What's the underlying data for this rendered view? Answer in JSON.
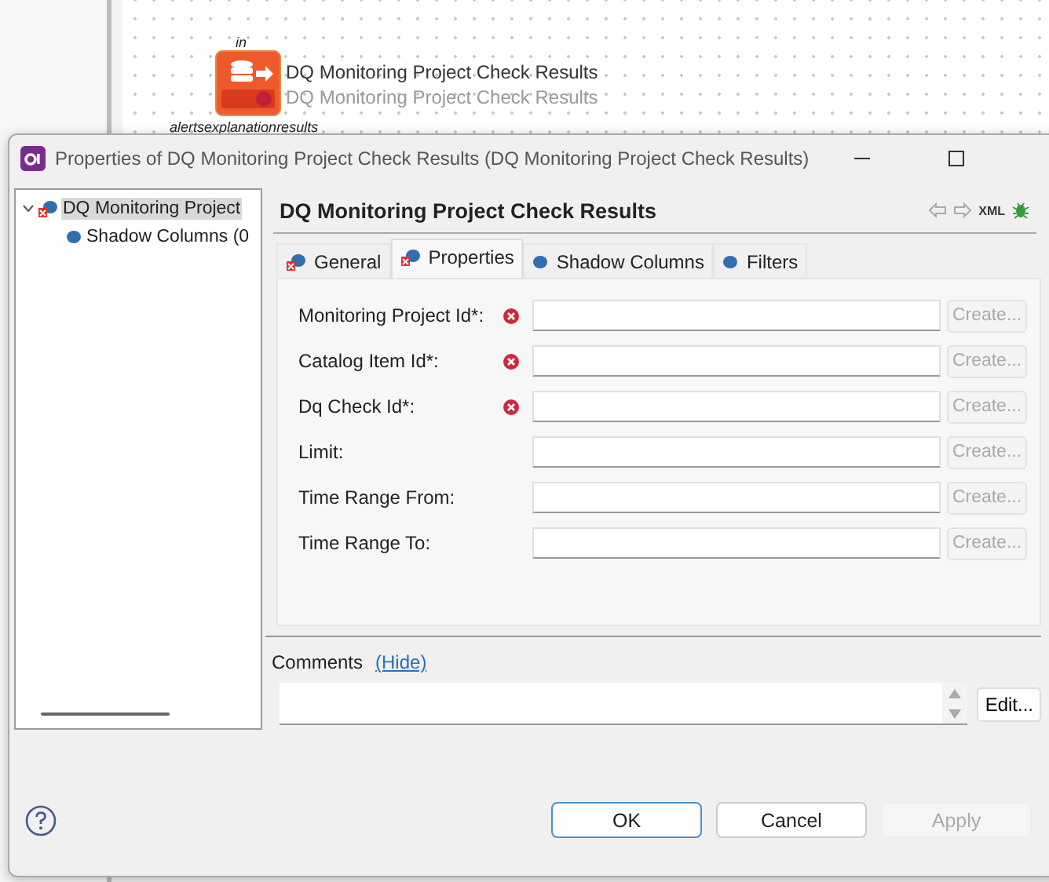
{
  "canvas": {
    "node": {
      "port_top": "in",
      "title": "DQ Monitoring Project Check Results",
      "subtitle": "DQ Monitoring Project Check Results",
      "ports_bottom": [
        "alerts",
        "explanation",
        "results"
      ]
    }
  },
  "window": {
    "title": "Properties of DQ Monitoring Project Check Results (DQ Monitoring Project Check Results)"
  },
  "tree": [
    {
      "label": "DQ Monitoring Project",
      "kind": "entity",
      "error": true,
      "selected": true,
      "expanded": true,
      "children": [
        {
          "label": "Shadow Columns (0",
          "kind": "dot",
          "error": false,
          "selected": false
        }
      ]
    }
  ],
  "header": {
    "title": "DQ Monitoring Project Check Results",
    "xml_label": "XML"
  },
  "tabs": [
    {
      "label": "General",
      "kind": "entity",
      "error": true,
      "selected": false
    },
    {
      "label": "Properties",
      "kind": "entity",
      "error": true,
      "selected": true
    },
    {
      "label": "Shadow Columns",
      "kind": "dot",
      "error": false,
      "selected": false
    },
    {
      "label": "Filters",
      "kind": "dot",
      "error": false,
      "selected": false
    }
  ],
  "fields": [
    {
      "label": "Monitoring Project Id*:",
      "error": true,
      "button": "Create...",
      "disabled": true
    },
    {
      "label": "Catalog Item Id*:",
      "error": true,
      "button": "Create...",
      "disabled": true
    },
    {
      "label": "Dq Check Id*:",
      "error": true,
      "button": "Create...",
      "disabled": true
    },
    {
      "label": "Limit:",
      "error": false,
      "button": "Create...",
      "disabled": true
    },
    {
      "label": "Time Range From:",
      "error": false,
      "button": "Create...",
      "disabled": true
    },
    {
      "label": "Time Range To:",
      "error": false,
      "button": "Create...",
      "disabled": true
    }
  ],
  "comments": {
    "label": "Comments",
    "link": "(Hide)",
    "edit_button": "Edit..."
  },
  "buttons": [
    {
      "label": "OK",
      "kind": "default",
      "disabled": false
    },
    {
      "label": "Cancel",
      "kind": "normal",
      "disabled": false
    },
    {
      "label": "Apply",
      "kind": "normal",
      "disabled": true
    }
  ]
}
